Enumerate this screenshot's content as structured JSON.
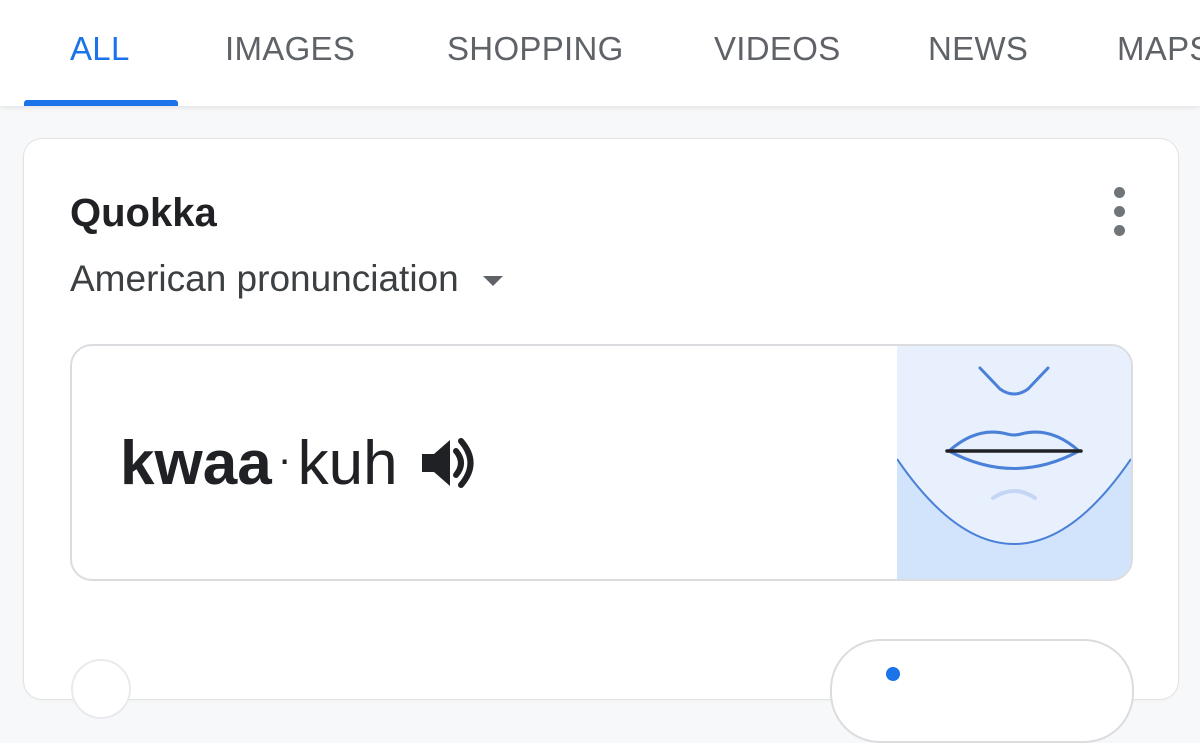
{
  "tabs": [
    {
      "label": "ALL",
      "active": true
    },
    {
      "label": "IMAGES",
      "active": false
    },
    {
      "label": "SHOPPING",
      "active": false
    },
    {
      "label": "VIDEOS",
      "active": false
    },
    {
      "label": "NEWS",
      "active": false
    },
    {
      "label": "MAPS",
      "active": false
    }
  ],
  "card": {
    "word": "Quokka",
    "variant": "American pronunciation",
    "more_icon": "more-vert-icon",
    "pronunciation": {
      "syllable_1": "kwaa",
      "separator": "·",
      "syllable_2": "kuh",
      "speaker_icon": "speaker-icon",
      "mouth_image": "mouth-diagram"
    }
  },
  "colors": {
    "accent": "#1a73e8",
    "text_primary": "#202124",
    "text_secondary": "#5f6368",
    "mouth_bg": "#e8f0fe",
    "mouth_chin": "#d2e3fc",
    "mouth_line": "#4a80d8"
  }
}
